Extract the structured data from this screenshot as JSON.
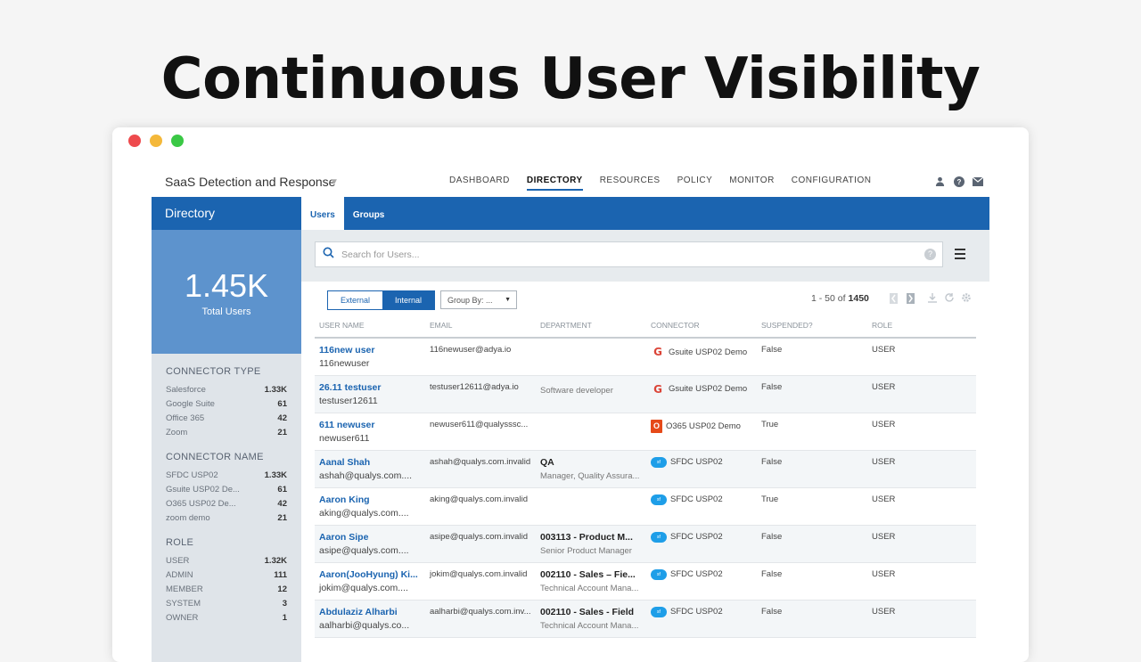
{
  "headline": "Continuous User Visibility",
  "app": {
    "brand": "SaaS Detection and Response",
    "nav": [
      "DASHBOARD",
      "DIRECTORY",
      "RESOURCES",
      "POLICY",
      "MONITOR",
      "CONFIGURATION"
    ],
    "active_nav": "DIRECTORY"
  },
  "sidebar": {
    "title": "Directory",
    "total_value": "1.45K",
    "total_label": "Total Users",
    "facets": [
      {
        "title": "CONNECTOR TYPE",
        "rows": [
          {
            "label": "Salesforce",
            "count": "1.33K"
          },
          {
            "label": "Google Suite",
            "count": "61"
          },
          {
            "label": "Office 365",
            "count": "42"
          },
          {
            "label": "Zoom",
            "count": "21"
          }
        ]
      },
      {
        "title": "CONNECTOR NAME",
        "rows": [
          {
            "label": "SFDC USP02",
            "count": "1.33K"
          },
          {
            "label": "Gsuite USP02 De...",
            "count": "61"
          },
          {
            "label": "O365 USP02 De...",
            "count": "42"
          },
          {
            "label": "zoom demo",
            "count": "21"
          }
        ]
      },
      {
        "title": "ROLE",
        "rows": [
          {
            "label": "USER",
            "count": "1.32K"
          },
          {
            "label": "ADMIN",
            "count": "111"
          },
          {
            "label": "MEMBER",
            "count": "12"
          },
          {
            "label": "SYSTEM",
            "count": "3"
          },
          {
            "label": "OWNER",
            "count": "1"
          }
        ]
      }
    ]
  },
  "tabs": [
    "Users",
    "Groups"
  ],
  "search": {
    "placeholder": "Search for Users..."
  },
  "toolbar": {
    "external": "External",
    "internal": "Internal",
    "groupby": "Group By: ...",
    "range": "1 - 50 of",
    "total": "1450"
  },
  "table": {
    "columns": [
      "USER NAME",
      "EMAIL",
      "DEPARTMENT",
      "CONNECTOR",
      "SUSPENDED?",
      "ROLE"
    ],
    "rows": [
      {
        "name": "116new user",
        "login": "116newuser",
        "email": "116newuser@adya.io",
        "dept": "",
        "dept_sub": "",
        "connector": "Gsuite USP02 Demo",
        "ctype": "google",
        "suspended": "False",
        "role": "USER"
      },
      {
        "name": "26.11 testuser",
        "login": "testuser12611",
        "email": "testuser12611@adya.io",
        "dept": "",
        "dept_sub": "Software developer",
        "connector": "Gsuite USP02 Demo",
        "ctype": "google",
        "suspended": "False",
        "role": "USER"
      },
      {
        "name": "611 newuser",
        "login": "newuser611",
        "email": "newuser611@qualysssc...",
        "dept": "",
        "dept_sub": "",
        "connector": "O365 USP02 Demo",
        "ctype": "office",
        "suspended": "True",
        "role": "USER"
      },
      {
        "name": "Aanal Shah",
        "login": "ashah@qualys.com....",
        "email": "ashah@qualys.com.invalid",
        "dept": "QA",
        "dept_sub": "Manager, Quality Assura...",
        "connector": "SFDC USP02",
        "ctype": "salesforce",
        "suspended": "False",
        "role": "USER"
      },
      {
        "name": "Aaron King",
        "login": "aking@qualys.com....",
        "email": "aking@qualys.com.invalid",
        "dept": "",
        "dept_sub": "",
        "connector": "SFDC USP02",
        "ctype": "salesforce",
        "suspended": "True",
        "role": "USER"
      },
      {
        "name": "Aaron Sipe",
        "login": "asipe@qualys.com....",
        "email": "asipe@qualys.com.invalid",
        "dept": "003113 - Product M...",
        "dept_sub": "Senior Product Manager",
        "connector": "SFDC USP02",
        "ctype": "salesforce",
        "suspended": "False",
        "role": "USER"
      },
      {
        "name": "Aaron(JooHyung) Ki...",
        "login": "jokim@qualys.com....",
        "email": "jokim@qualys.com.invalid",
        "dept": "002110 - Sales – Fie...",
        "dept_sub": "Technical Account Mana...",
        "connector": "SFDC USP02",
        "ctype": "salesforce",
        "suspended": "False",
        "role": "USER"
      },
      {
        "name": "Abdulaziz Alharbi",
        "login": "aalharbi@qualys.co...",
        "email": "aalharbi@qualys.com.inv...",
        "dept": "002110 - Sales - Field",
        "dept_sub": "Technical Account Mana...",
        "connector": "SFDC USP02",
        "ctype": "salesforce",
        "suspended": "False",
        "role": "USER"
      }
    ]
  },
  "colors": {
    "accent": "#1b64b0",
    "stat_panel": "#5d93cd",
    "sidebar_bg": "#dfe4e9"
  }
}
